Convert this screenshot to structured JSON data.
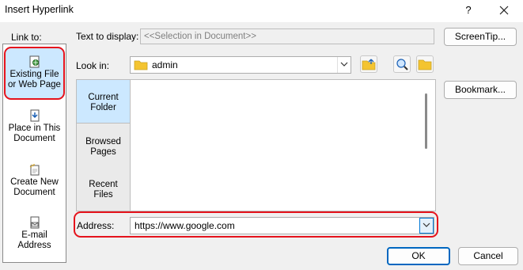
{
  "window": {
    "title": "Insert Hyperlink",
    "help_label": "?",
    "close_label": "✕"
  },
  "link_to": {
    "label": "Link to:",
    "items": [
      {
        "id": "existing",
        "line1": "Existing File",
        "line2": "or Web Page",
        "selected": true,
        "icon": "existing-file-icon"
      },
      {
        "id": "place",
        "line1": "Place in This",
        "line2": "Document",
        "selected": false,
        "icon": "place-in-document-icon"
      },
      {
        "id": "create",
        "line1": "Create New",
        "line2": "Document",
        "selected": false,
        "icon": "new-document-icon"
      },
      {
        "id": "email",
        "line1": "E-mail",
        "line2": "Address",
        "selected": false,
        "icon": "email-icon"
      }
    ]
  },
  "text_to_display": {
    "label": "Text to display:",
    "value": "<<Selection in Document>>"
  },
  "buttons": {
    "screentip": "ScreenTip...",
    "bookmark": "Bookmark...",
    "ok": "OK",
    "cancel": "Cancel"
  },
  "look_in": {
    "label": "Look in:",
    "value": "admin"
  },
  "side_nav": [
    {
      "line1": "Current",
      "line2": "Folder",
      "selected": true
    },
    {
      "line1": "Browsed",
      "line2": "Pages",
      "selected": false
    },
    {
      "line1": "Recent",
      "line2": "Files",
      "selected": false
    }
  ],
  "address": {
    "label": "Address:",
    "value": "https://www.google.com"
  },
  "colors": {
    "accent": "#0067c0",
    "highlight_ring": "#e5131c",
    "selection": "#cce8ff"
  }
}
